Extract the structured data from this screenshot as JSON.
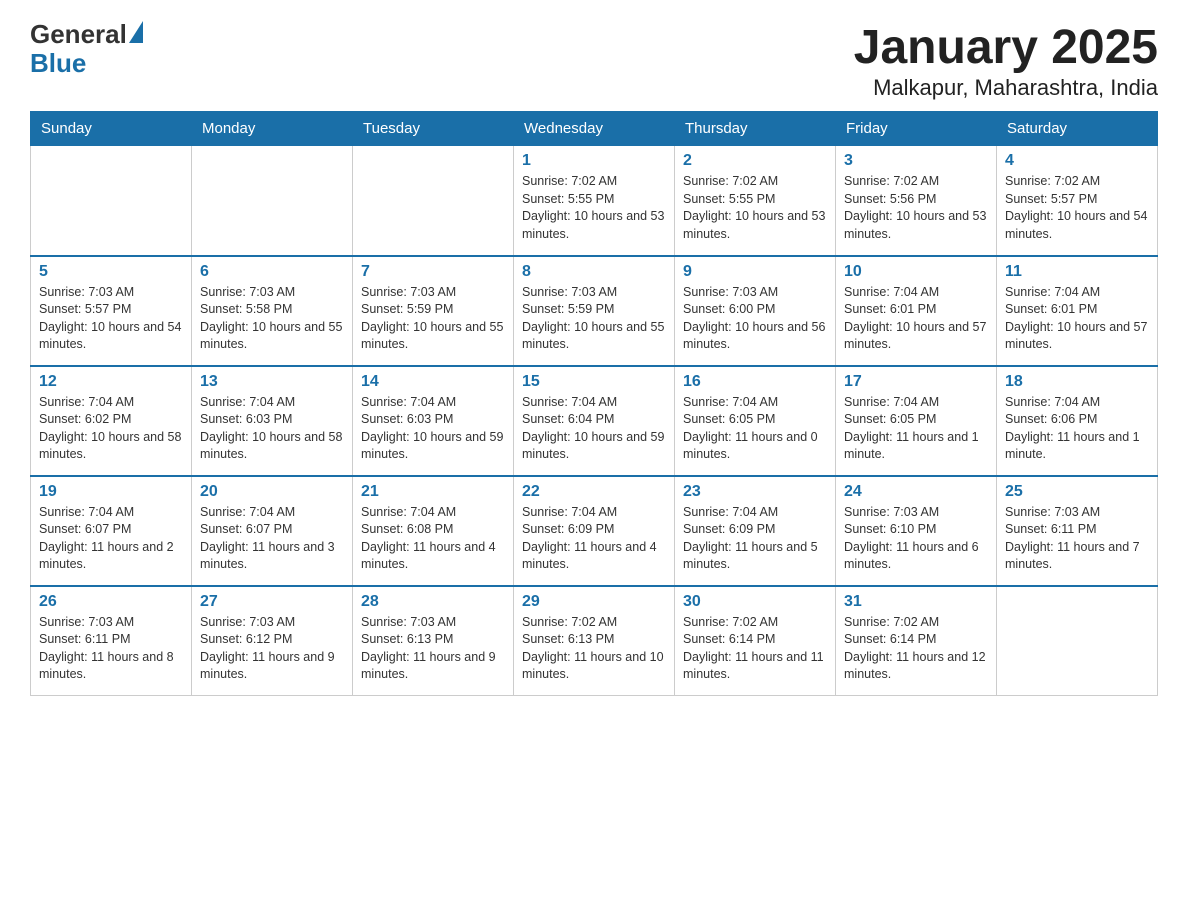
{
  "header": {
    "logo": {
      "general": "General",
      "blue": "Blue"
    },
    "title": "January 2025",
    "subtitle": "Malkapur, Maharashtra, India"
  },
  "calendar": {
    "days_of_week": [
      "Sunday",
      "Monday",
      "Tuesday",
      "Wednesday",
      "Thursday",
      "Friday",
      "Saturday"
    ],
    "weeks": [
      [
        {
          "day": "",
          "info": ""
        },
        {
          "day": "",
          "info": ""
        },
        {
          "day": "",
          "info": ""
        },
        {
          "day": "1",
          "info": "Sunrise: 7:02 AM\nSunset: 5:55 PM\nDaylight: 10 hours and 53 minutes."
        },
        {
          "day": "2",
          "info": "Sunrise: 7:02 AM\nSunset: 5:55 PM\nDaylight: 10 hours and 53 minutes."
        },
        {
          "day": "3",
          "info": "Sunrise: 7:02 AM\nSunset: 5:56 PM\nDaylight: 10 hours and 53 minutes."
        },
        {
          "day": "4",
          "info": "Sunrise: 7:02 AM\nSunset: 5:57 PM\nDaylight: 10 hours and 54 minutes."
        }
      ],
      [
        {
          "day": "5",
          "info": "Sunrise: 7:03 AM\nSunset: 5:57 PM\nDaylight: 10 hours and 54 minutes."
        },
        {
          "day": "6",
          "info": "Sunrise: 7:03 AM\nSunset: 5:58 PM\nDaylight: 10 hours and 55 minutes."
        },
        {
          "day": "7",
          "info": "Sunrise: 7:03 AM\nSunset: 5:59 PM\nDaylight: 10 hours and 55 minutes."
        },
        {
          "day": "8",
          "info": "Sunrise: 7:03 AM\nSunset: 5:59 PM\nDaylight: 10 hours and 55 minutes."
        },
        {
          "day": "9",
          "info": "Sunrise: 7:03 AM\nSunset: 6:00 PM\nDaylight: 10 hours and 56 minutes."
        },
        {
          "day": "10",
          "info": "Sunrise: 7:04 AM\nSunset: 6:01 PM\nDaylight: 10 hours and 57 minutes."
        },
        {
          "day": "11",
          "info": "Sunrise: 7:04 AM\nSunset: 6:01 PM\nDaylight: 10 hours and 57 minutes."
        }
      ],
      [
        {
          "day": "12",
          "info": "Sunrise: 7:04 AM\nSunset: 6:02 PM\nDaylight: 10 hours and 58 minutes."
        },
        {
          "day": "13",
          "info": "Sunrise: 7:04 AM\nSunset: 6:03 PM\nDaylight: 10 hours and 58 minutes."
        },
        {
          "day": "14",
          "info": "Sunrise: 7:04 AM\nSunset: 6:03 PM\nDaylight: 10 hours and 59 minutes."
        },
        {
          "day": "15",
          "info": "Sunrise: 7:04 AM\nSunset: 6:04 PM\nDaylight: 10 hours and 59 minutes."
        },
        {
          "day": "16",
          "info": "Sunrise: 7:04 AM\nSunset: 6:05 PM\nDaylight: 11 hours and 0 minutes."
        },
        {
          "day": "17",
          "info": "Sunrise: 7:04 AM\nSunset: 6:05 PM\nDaylight: 11 hours and 1 minute."
        },
        {
          "day": "18",
          "info": "Sunrise: 7:04 AM\nSunset: 6:06 PM\nDaylight: 11 hours and 1 minute."
        }
      ],
      [
        {
          "day": "19",
          "info": "Sunrise: 7:04 AM\nSunset: 6:07 PM\nDaylight: 11 hours and 2 minutes."
        },
        {
          "day": "20",
          "info": "Sunrise: 7:04 AM\nSunset: 6:07 PM\nDaylight: 11 hours and 3 minutes."
        },
        {
          "day": "21",
          "info": "Sunrise: 7:04 AM\nSunset: 6:08 PM\nDaylight: 11 hours and 4 minutes."
        },
        {
          "day": "22",
          "info": "Sunrise: 7:04 AM\nSunset: 6:09 PM\nDaylight: 11 hours and 4 minutes."
        },
        {
          "day": "23",
          "info": "Sunrise: 7:04 AM\nSunset: 6:09 PM\nDaylight: 11 hours and 5 minutes."
        },
        {
          "day": "24",
          "info": "Sunrise: 7:03 AM\nSunset: 6:10 PM\nDaylight: 11 hours and 6 minutes."
        },
        {
          "day": "25",
          "info": "Sunrise: 7:03 AM\nSunset: 6:11 PM\nDaylight: 11 hours and 7 minutes."
        }
      ],
      [
        {
          "day": "26",
          "info": "Sunrise: 7:03 AM\nSunset: 6:11 PM\nDaylight: 11 hours and 8 minutes."
        },
        {
          "day": "27",
          "info": "Sunrise: 7:03 AM\nSunset: 6:12 PM\nDaylight: 11 hours and 9 minutes."
        },
        {
          "day": "28",
          "info": "Sunrise: 7:03 AM\nSunset: 6:13 PM\nDaylight: 11 hours and 9 minutes."
        },
        {
          "day": "29",
          "info": "Sunrise: 7:02 AM\nSunset: 6:13 PM\nDaylight: 11 hours and 10 minutes."
        },
        {
          "day": "30",
          "info": "Sunrise: 7:02 AM\nSunset: 6:14 PM\nDaylight: 11 hours and 11 minutes."
        },
        {
          "day": "31",
          "info": "Sunrise: 7:02 AM\nSunset: 6:14 PM\nDaylight: 11 hours and 12 minutes."
        },
        {
          "day": "",
          "info": ""
        }
      ]
    ]
  }
}
